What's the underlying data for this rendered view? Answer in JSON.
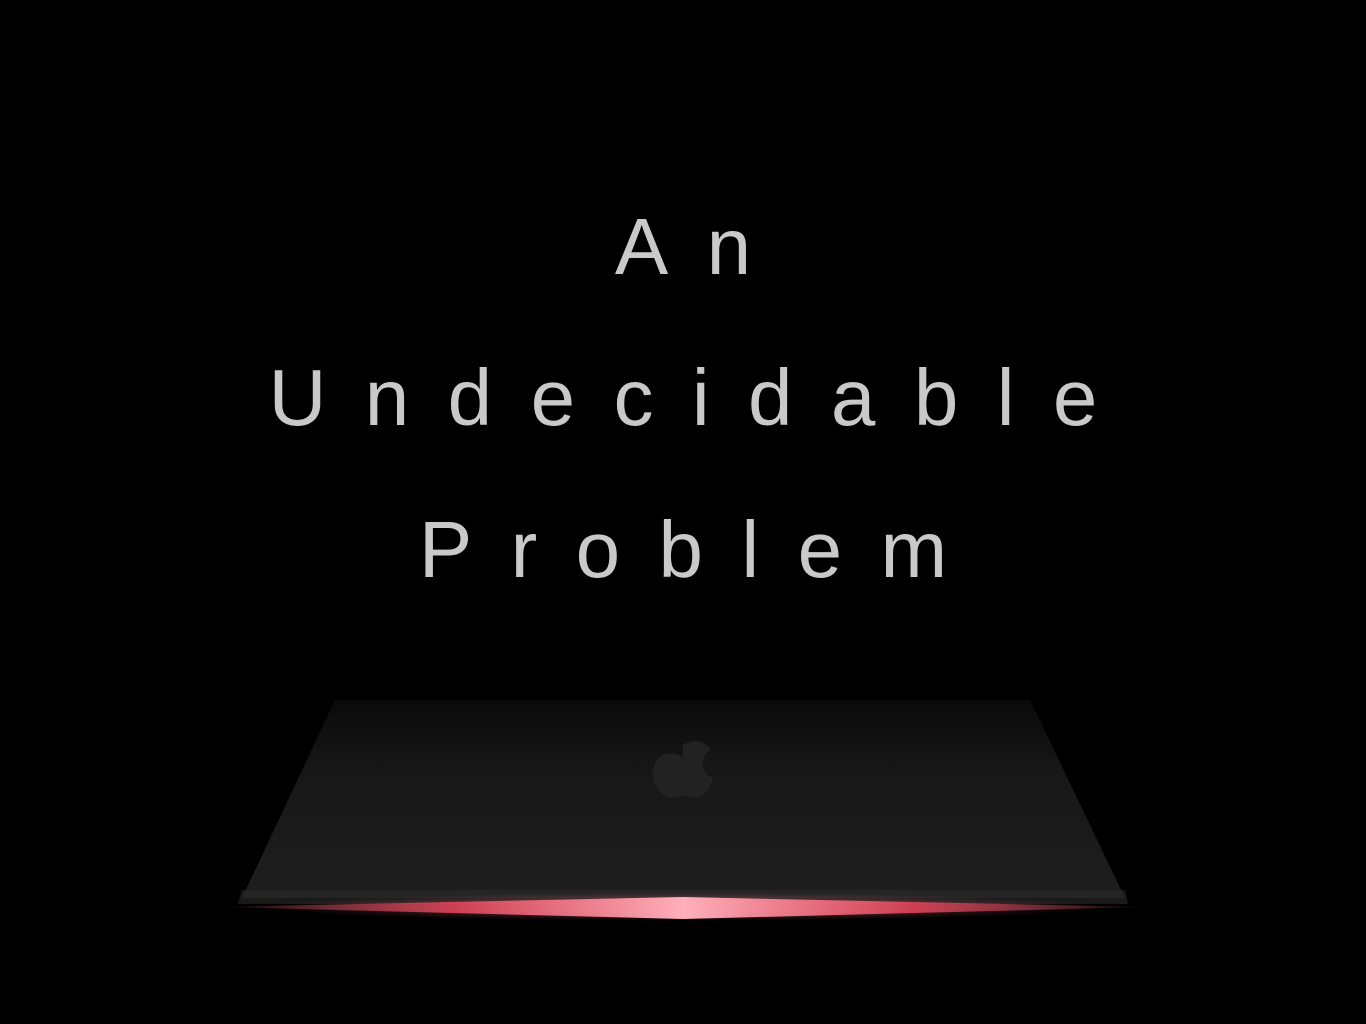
{
  "title": {
    "line1": "An",
    "line2": "Undecidable",
    "line3": "Problem"
  },
  "laptop": {
    "logo_icon": "apple-logo-icon",
    "glow_color": "#ff6b7f",
    "lid_color": "#1c1c1c"
  },
  "colors": {
    "background": "#000000",
    "text": "#c9c9c9"
  }
}
